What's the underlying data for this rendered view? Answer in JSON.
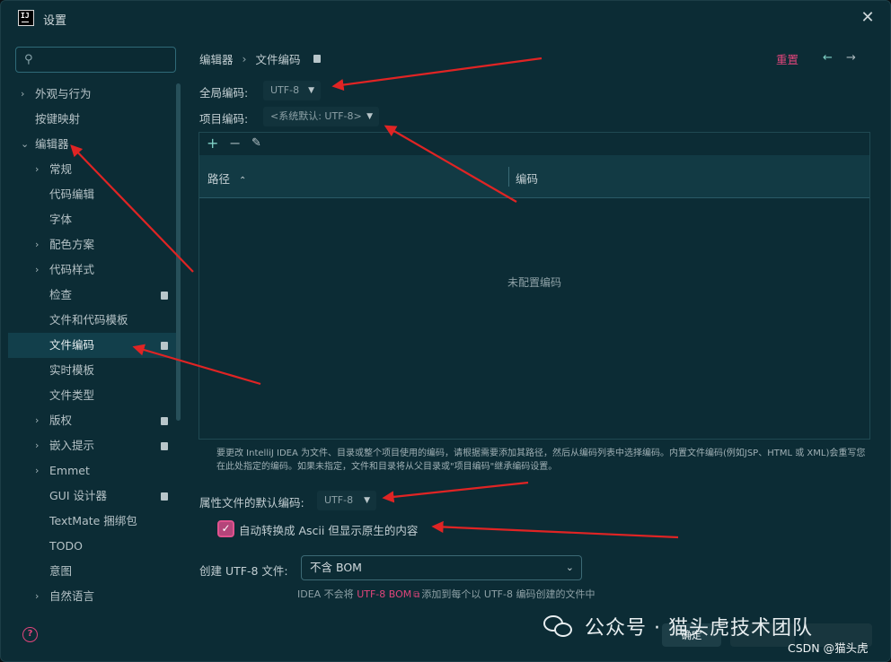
{
  "window": {
    "title": "设置",
    "app_icon_text": "IJ"
  },
  "search": {
    "placeholder": ""
  },
  "sidebar": {
    "items": [
      {
        "label": "外观与行为",
        "chevron": "›",
        "level": 0,
        "badge": false
      },
      {
        "label": "按键映射",
        "chevron": "",
        "level": 0,
        "badge": false
      },
      {
        "label": "编辑器",
        "chevron": "⌄",
        "level": 0,
        "badge": false
      },
      {
        "label": "常规",
        "chevron": "›",
        "level": 1,
        "badge": false
      },
      {
        "label": "代码编辑",
        "chevron": "",
        "level": 1,
        "badge": false
      },
      {
        "label": "字体",
        "chevron": "",
        "level": 1,
        "badge": false
      },
      {
        "label": "配色方案",
        "chevron": "›",
        "level": 1,
        "badge": false
      },
      {
        "label": "代码样式",
        "chevron": "›",
        "level": 1,
        "badge": false
      },
      {
        "label": "检查",
        "chevron": "",
        "level": 1,
        "badge": true
      },
      {
        "label": "文件和代码模板",
        "chevron": "",
        "level": 1,
        "badge": false
      },
      {
        "label": "文件编码",
        "chevron": "",
        "level": 1,
        "badge": true,
        "selected": true
      },
      {
        "label": "实时模板",
        "chevron": "",
        "level": 1,
        "badge": false
      },
      {
        "label": "文件类型",
        "chevron": "",
        "level": 1,
        "badge": false
      },
      {
        "label": "版权",
        "chevron": "›",
        "level": 1,
        "badge": true
      },
      {
        "label": "嵌入提示",
        "chevron": "›",
        "level": 1,
        "badge": true
      },
      {
        "label": "Emmet",
        "chevron": "›",
        "level": 1,
        "badge": false
      },
      {
        "label": "GUI 设计器",
        "chevron": "",
        "level": 1,
        "badge": true
      },
      {
        "label": "TextMate 捆绑包",
        "chevron": "",
        "level": 1,
        "badge": false
      },
      {
        "label": "TODO",
        "chevron": "",
        "level": 1,
        "badge": false
      },
      {
        "label": "意图",
        "chevron": "",
        "level": 1,
        "badge": false
      },
      {
        "label": "自然语言",
        "chevron": "›",
        "level": 1,
        "badge": false
      }
    ]
  },
  "header": {
    "crumb_parent": "编辑器",
    "crumb_sep": "›",
    "crumb_current": "文件编码",
    "reset": "重置",
    "back_icon": "←",
    "forward_icon": "→"
  },
  "global_encoding": {
    "label": "全局编码:",
    "value": "UTF-8"
  },
  "project_encoding": {
    "label": "项目编码:",
    "value": "<系统默认: UTF-8>"
  },
  "table": {
    "add_icon": "+",
    "remove_icon": "−",
    "edit_icon": "✎",
    "columns": [
      "路径",
      "编码"
    ],
    "sort_icon": "⌃",
    "empty_text": "未配置编码"
  },
  "description": "要更改 IntelliJ IDEA 为文件、目录或整个项目使用的编码，请根据需要添加其路径，然后从编码列表中选择编码。内置文件编码(例如JSP、HTML 或 XML)会重写您在此处指定的编码。如果未指定，文件和目录将从父目录或\"项目编码\"继承编码设置。",
  "properties_encoding": {
    "label": "属性文件的默认编码:",
    "value": "UTF-8"
  },
  "ascii_checkbox": {
    "label": "自动转换成 Ascii 但显示原生的内容",
    "checked": true
  },
  "bom": {
    "label": "创建 UTF-8 文件:",
    "value": "不含 BOM",
    "hint_pre": "IDEA 不会将",
    "hint_link": "UTF-8 BOM",
    "hint_post": "添加到每个以 UTF-8 编码创建的文件中"
  },
  "buttons": {
    "ok": "确定",
    "cancel": "",
    "apply": ""
  },
  "overlay": {
    "watermark": "公众号 · 猫头虎技术团队",
    "csdn": "CSDN @猫头虎"
  },
  "colors": {
    "background": "#0c2c35",
    "accent": "#e0457b",
    "selection": "#123f4b",
    "annotation_arrow": "#e02424"
  }
}
